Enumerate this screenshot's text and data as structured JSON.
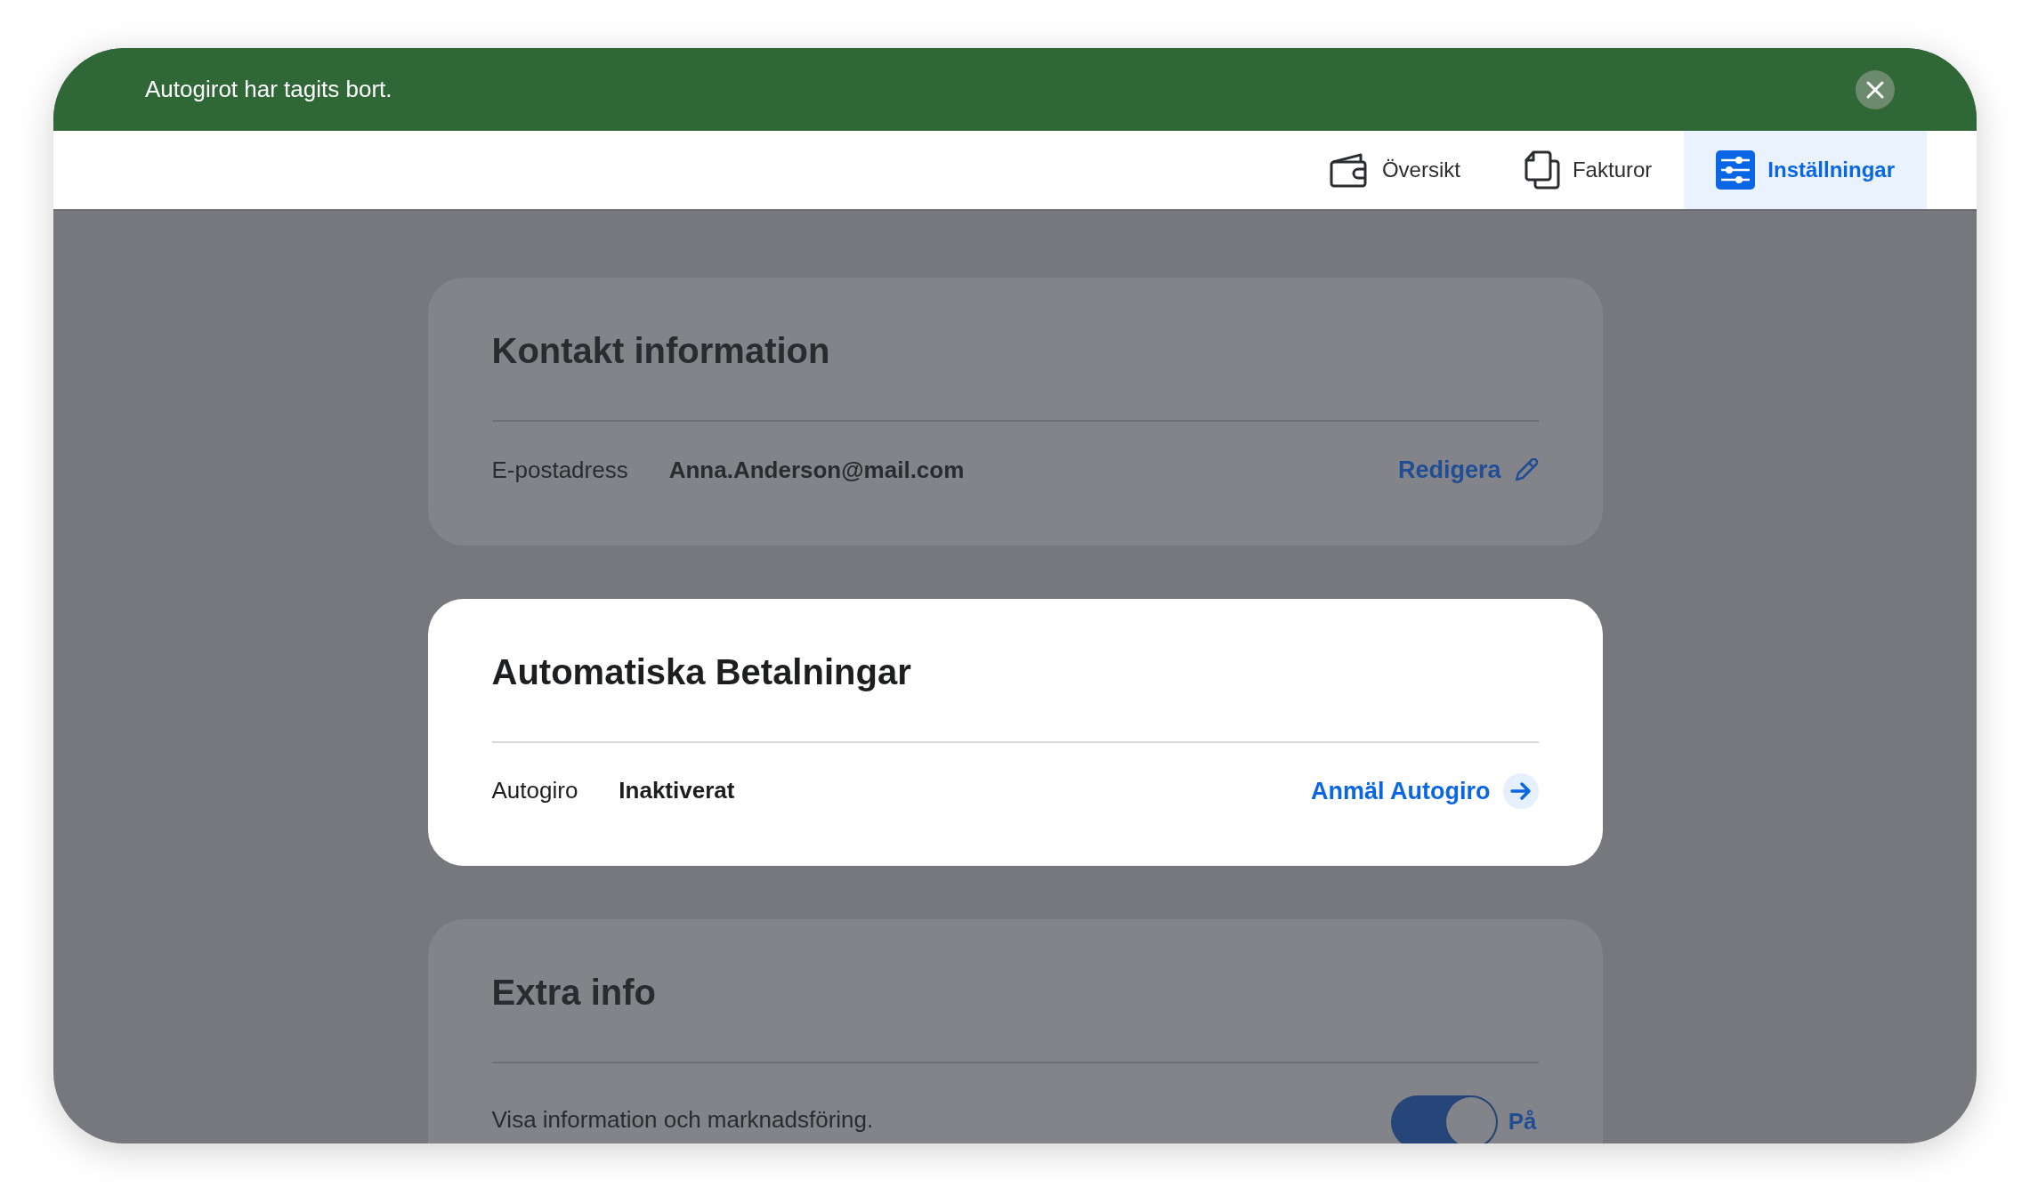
{
  "banner": {
    "message": "Autogirot har tagits bort."
  },
  "nav": {
    "tabs": [
      {
        "label": "Översikt",
        "selected": false
      },
      {
        "label": "Fakturor",
        "selected": false
      },
      {
        "label": "Inställningar",
        "selected": true
      }
    ]
  },
  "sections": [
    {
      "title": "Kontakt information",
      "focused": false,
      "row": {
        "kind": "action",
        "label": "E-postadress",
        "value": "Anna.Anderson@mail.com",
        "action": {
          "kind": "edit",
          "label": "Redigera"
        }
      }
    },
    {
      "title": "Automatiska Betalningar",
      "focused": true,
      "row": {
        "kind": "action",
        "label": "Autogiro",
        "value": "Inaktiverat",
        "action": {
          "kind": "navigate",
          "label": "Anmäl Autogiro"
        }
      }
    },
    {
      "title": "Extra info",
      "focused": false,
      "row": {
        "kind": "toggle",
        "label": "Visa information och marknadsföring.",
        "on": true,
        "state_label": "På"
      }
    }
  ]
}
